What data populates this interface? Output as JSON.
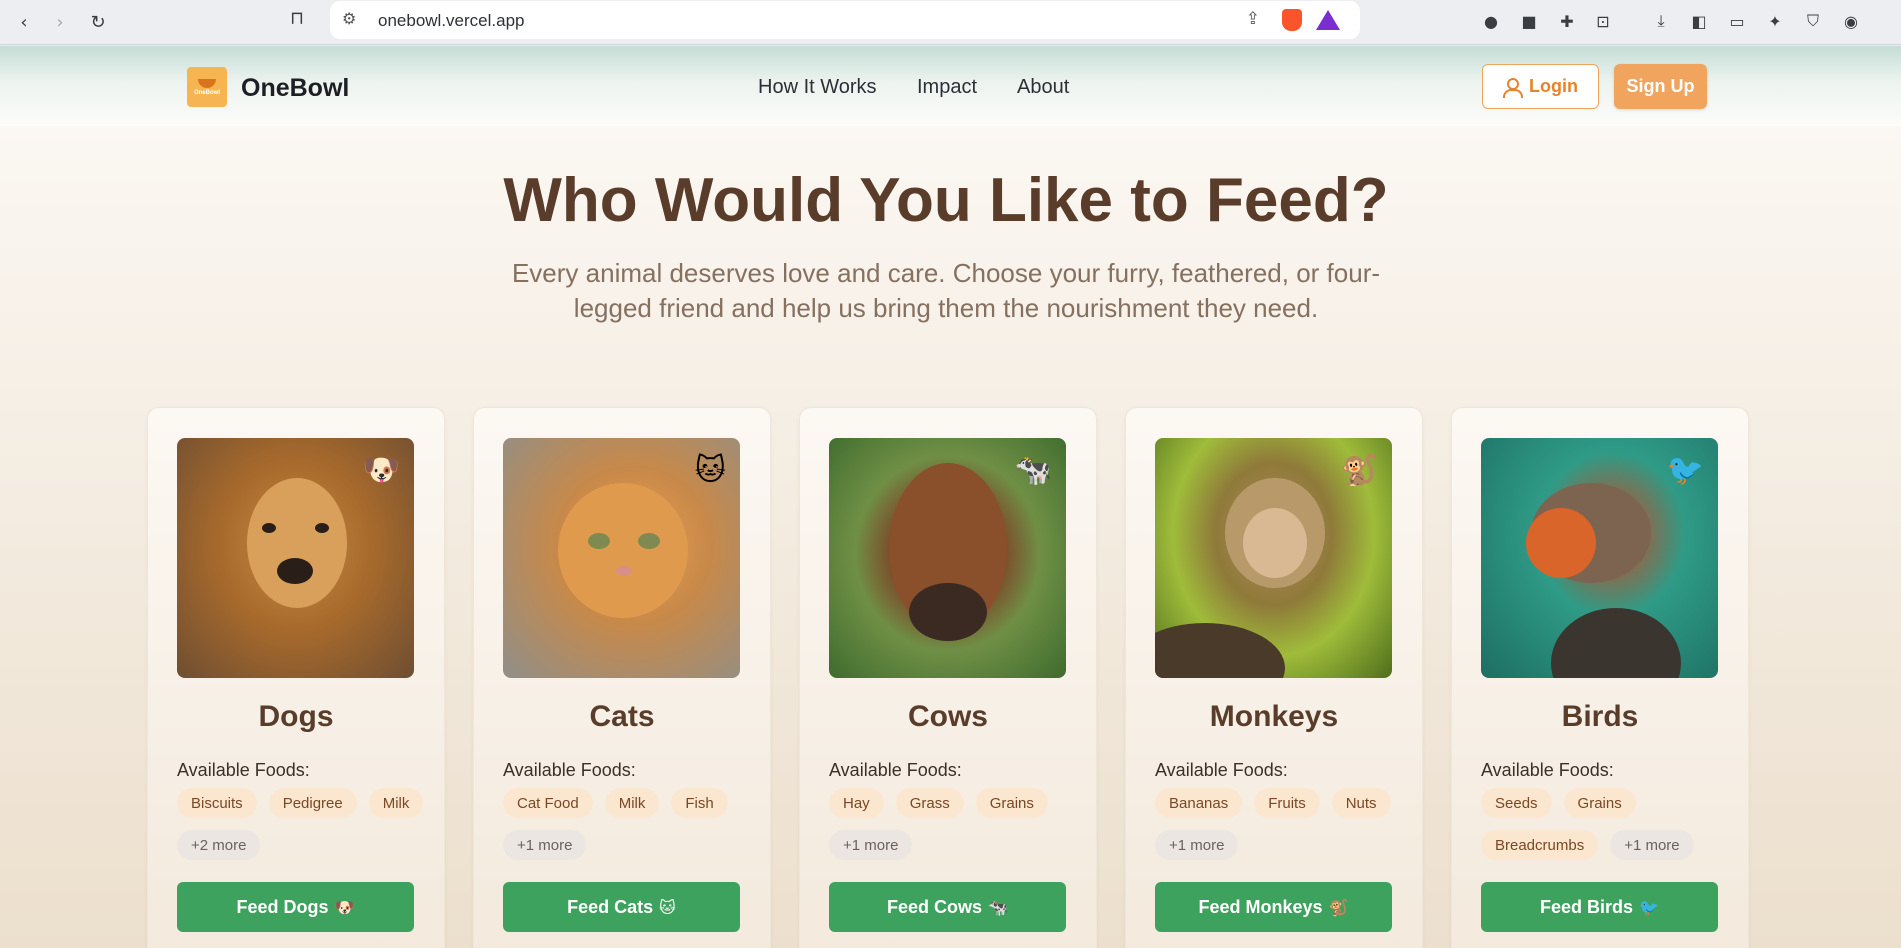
{
  "browser": {
    "url": "onebowl.vercel.app",
    "back_icon": "‹",
    "forward_icon": "›",
    "reload_icon": "↻",
    "bookmark_icon": "⊓",
    "tune_icon": "⚙",
    "share_icon": "⇪"
  },
  "header": {
    "logo_mini": "OneBowl",
    "brand": "OneBowl",
    "nav": [
      "How It Works",
      "Impact",
      "About"
    ],
    "login_label": "Login",
    "signup_label": "Sign Up"
  },
  "hero": {
    "title": "Who Would You Like to Feed?",
    "subtitle": "Every animal deserves love and care. Choose your furry, feathered, or four-legged friend and help us bring them the nourishment they need."
  },
  "foods_label": "Available Foods:",
  "animals": [
    {
      "name": "Dogs",
      "emoji": "🐶",
      "foods": [
        "Biscuits",
        "Pedigree",
        "Milk"
      ],
      "more": "+2 more",
      "button": "Feed Dogs",
      "button_emoji": "🐶"
    },
    {
      "name": "Cats",
      "emoji": "🐱",
      "foods": [
        "Cat Food",
        "Milk",
        "Fish"
      ],
      "more": "+1 more",
      "button": "Feed Cats",
      "button_emoji": "🐱"
    },
    {
      "name": "Cows",
      "emoji": "🐄",
      "foods": [
        "Hay",
        "Grass",
        "Grains"
      ],
      "more": "+1 more",
      "button": "Feed Cows",
      "button_emoji": "🐄"
    },
    {
      "name": "Monkeys",
      "emoji": "🐒",
      "foods": [
        "Bananas",
        "Fruits",
        "Nuts"
      ],
      "more": "+1 more",
      "button": "Feed Monkeys",
      "button_emoji": "🐒"
    },
    {
      "name": "Birds",
      "emoji": "🐦",
      "foods": [
        "Seeds",
        "Grains",
        "Breadcrumbs"
      ],
      "more": "+1 more",
      "button": "Feed Birds",
      "button_emoji": "🐦"
    }
  ],
  "colors": {
    "accent": "#f1a45d",
    "heading": "#5a3c2b",
    "feed_button": "#3ea25f",
    "chip_bg": "#fbe7cf"
  }
}
